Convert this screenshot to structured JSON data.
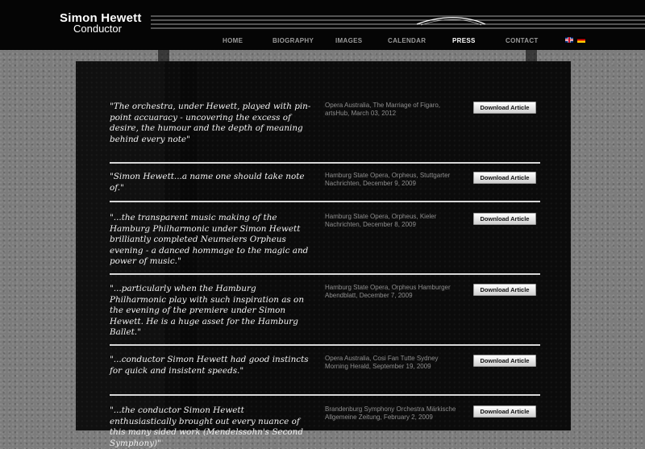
{
  "site": {
    "name": "Simon Hewett",
    "role": "Conductor"
  },
  "nav": {
    "items": [
      {
        "label": "HOME",
        "active": false
      },
      {
        "label": "BIOGRAPHY",
        "active": false
      },
      {
        "label": "IMAGES",
        "active": false
      },
      {
        "label": "CALENDAR",
        "active": false
      },
      {
        "label": "PRESS",
        "active": true
      },
      {
        "label": "CONTACT",
        "active": false
      }
    ],
    "languages": [
      {
        "icon": "uk-flag-icon"
      },
      {
        "icon": "german-flag-icon"
      }
    ]
  },
  "press": {
    "button_label": "Download Article",
    "articles": [
      {
        "quote": "\"The orchestra, under Hewett, played with pin-point accuaracy - uncovering the excess of desire, the humour and the depth of meaning behind every note\"",
        "source": "Opera Australia, The Marriage of Figaro, artsHub, March 03, 2012"
      },
      {
        "quote": "\"Simon Hewett...a name one should take note of.\"",
        "source": "Hamburg State Opera, Orpheus, Stuttgarter Nachrichten, December 9, 2009"
      },
      {
        "quote": "\"...the transparent music making of the Hamburg Philharmonic under Simon Hewett brilliantly completed Neumeiers Orpheus evening - a danced hommage to the magic and power of music.\"",
        "source": "Hamburg State Opera, Orpheus, Kieler Nachrichten, December 8, 2009"
      },
      {
        "quote": "\"...particularly when the Hamburg Philharmonic play with such inspiration as on the evening of the premiere under Simon Hewett. He is a huge asset for the Hamburg Ballet.\"",
        "source": "Hamburg State Opera, Orpheus Hamburger Abendblatt, December 7, 2009"
      },
      {
        "quote": "\"...conductor Simon Hewett had good instincts for quick and insistent speeds.\"",
        "source": "Opera Australia, Cosi Fan Tutte Sydney Morning Herald, September 19, 2009"
      },
      {
        "quote": "\"...the conductor Simon Hewett enthusiastically brought out every nuance of this many sided work (Mendelssohn's Second Symphony)\"",
        "source": "Brandenburg Symphony Orchestra Märkische Allgemeine Zeitung, February 2, 2009"
      }
    ]
  }
}
